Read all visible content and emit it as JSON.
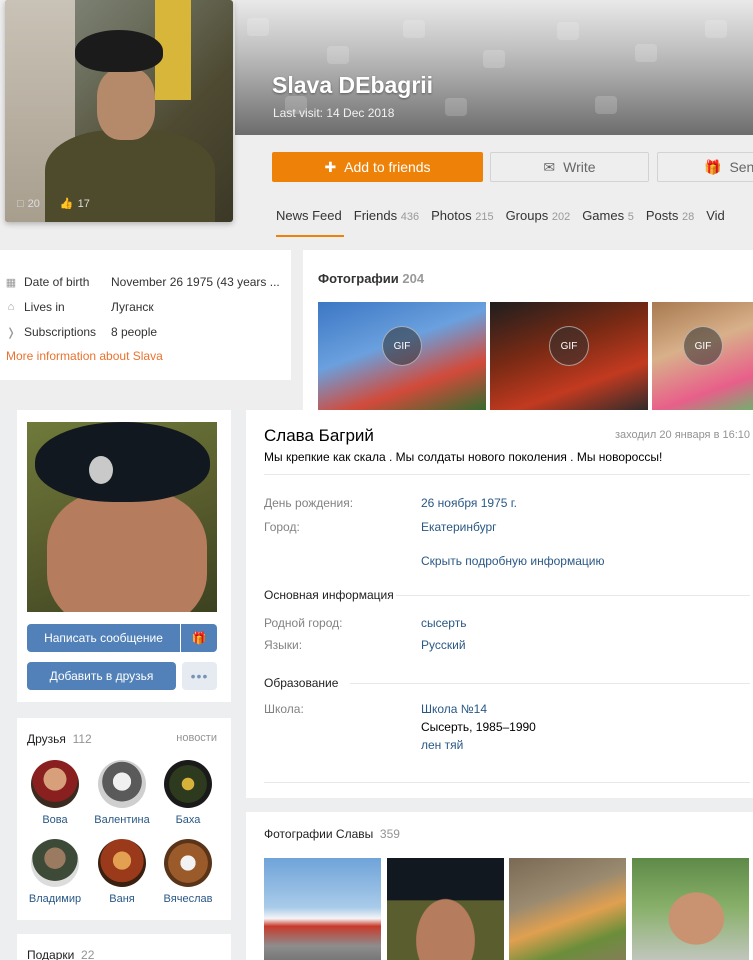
{
  "ok": {
    "name": "Slava DEbagrii",
    "last_visit": "Last visit: 14 Dec 2018",
    "avatar_stats": {
      "comments": "20",
      "likes": "17"
    },
    "buttons": {
      "add": "Add to friends",
      "write": "Write",
      "send": "Send"
    },
    "tabs": [
      {
        "label": "News Feed",
        "count": ""
      },
      {
        "label": "Friends",
        "count": "436"
      },
      {
        "label": "Photos",
        "count": "215"
      },
      {
        "label": "Groups",
        "count": "202"
      },
      {
        "label": "Games",
        "count": "5"
      },
      {
        "label": "Posts",
        "count": "28"
      },
      {
        "label": "Vid",
        "count": ""
      }
    ],
    "info": {
      "birth_label": "Date of birth",
      "birth_value": "November 26 1975 (43 years ...",
      "lives_label": "Lives in",
      "lives_value": "Луганск",
      "subs_label": "Subscriptions",
      "subs_value": "8 people",
      "more": "More information about Slava"
    },
    "photos": {
      "title": "Фотографии",
      "count": "204",
      "gif_label": "GIF"
    },
    "accent_color": "#ee8208"
  },
  "vk": {
    "buttons": {
      "message": "Написать сообщение",
      "add_friend": "Добавить в друзья",
      "more": "•••"
    },
    "friends": {
      "title": "Друзья",
      "count": "112",
      "news": "новости",
      "list": [
        "Вова",
        "Валентина",
        "Баха",
        "Владимир",
        "Ваня",
        "Вячеслав"
      ]
    },
    "gifts": {
      "title": "Подарки",
      "count": "22"
    },
    "profile": {
      "name": "Слава Багрий",
      "online": "заходил 20 января в 16:10",
      "status": "Мы крепкие как скала . Мы солдаты нового поколения . Мы новороссы!",
      "birthday_label": "День рождения:",
      "birthday_value": "26 ноября 1975 г.",
      "city_label": "Город:",
      "city_value": "Екатеринбург",
      "hide_details": "Скрыть подробную информацию",
      "main_info": "Основная информация",
      "hometown_label": "Родной город:",
      "hometown_value": "сысерть",
      "languages_label": "Языки:",
      "languages_value": "Русский",
      "education": "Образование",
      "school_label": "Школа:",
      "school_value": "Школа №14",
      "school_years": "Сысерть, 1985–1990",
      "school_extra": "лен тяй"
    },
    "photos": {
      "title": "Фотографии Славы",
      "count": "359"
    },
    "accent_color": "#5181b8"
  }
}
